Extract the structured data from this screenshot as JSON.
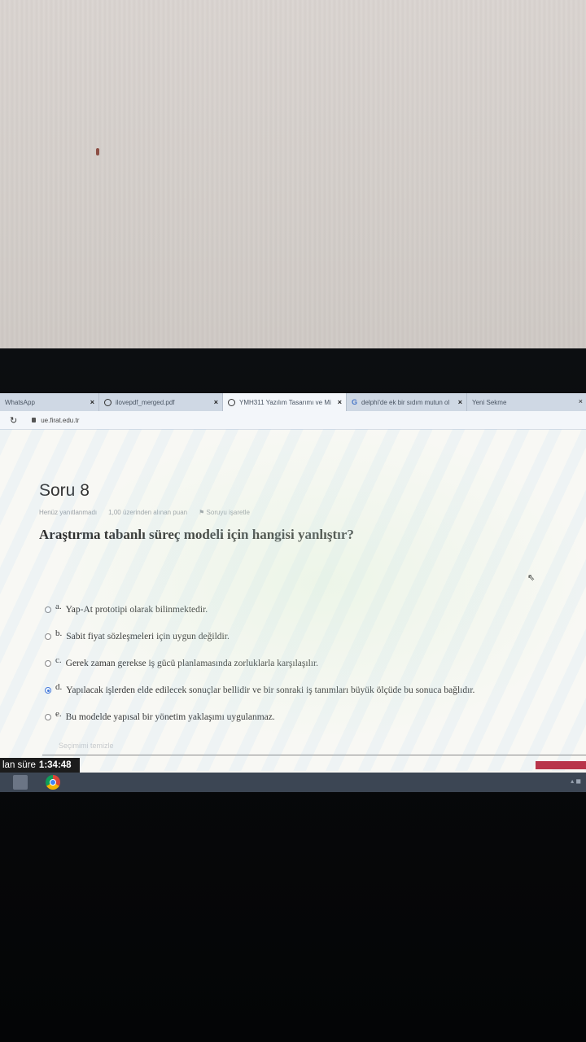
{
  "tabs": [
    {
      "label": "WhatsApp",
      "active": false
    },
    {
      "label": "ilovepdf_merged.pdf",
      "active": false
    },
    {
      "label": "YMH311 Yazılım Tasarımı ve Mi",
      "active": true
    },
    {
      "label": "delphi'de ek bir sıdım mutun ol",
      "active": false
    },
    {
      "label": "Yeni Sekme",
      "active": false
    }
  ],
  "address": {
    "url": "ue.firat.edu.tr"
  },
  "question": {
    "title": "Soru 8",
    "status": "Henüz yanıtlanmadı",
    "points": "1,00 üzerinden alınan puan",
    "flag": "Soruyu işaretle",
    "text": "Araştırma tabanlı süreç modeli için hangisi yanlıştır?"
  },
  "options": [
    {
      "letter": "a.",
      "text": "Yap-At prototipi olarak bilinmektedir.",
      "selected": false
    },
    {
      "letter": "b.",
      "text": "Sabit fiyat sözleşmeleri için uygun değildir.",
      "selected": false
    },
    {
      "letter": "c.",
      "text": "Gerek zaman gerekse iş gücü planlamasında zorluklarla karşılaşılır.",
      "selected": false
    },
    {
      "letter": "d.",
      "text": "Yapılacak işlerden elde edilecek sonuçlar bellidir ve bir sonraki iş tanımları büyük ölçüde bu sonuca bağlıdır.",
      "selected": true
    },
    {
      "letter": "e.",
      "text": "Bu modelde yapısal bir yönetim yaklaşımı uygulanmaz.",
      "selected": false
    }
  ],
  "clear_choice": "Seçimimi temizle",
  "timer": {
    "label": "lan süre",
    "value": "1:34:48"
  },
  "colors": {
    "accent": "#3a6fd8",
    "timer_bg": "#1c1c1c",
    "taskbar": "#3c4654",
    "submit": "#b8344a"
  }
}
